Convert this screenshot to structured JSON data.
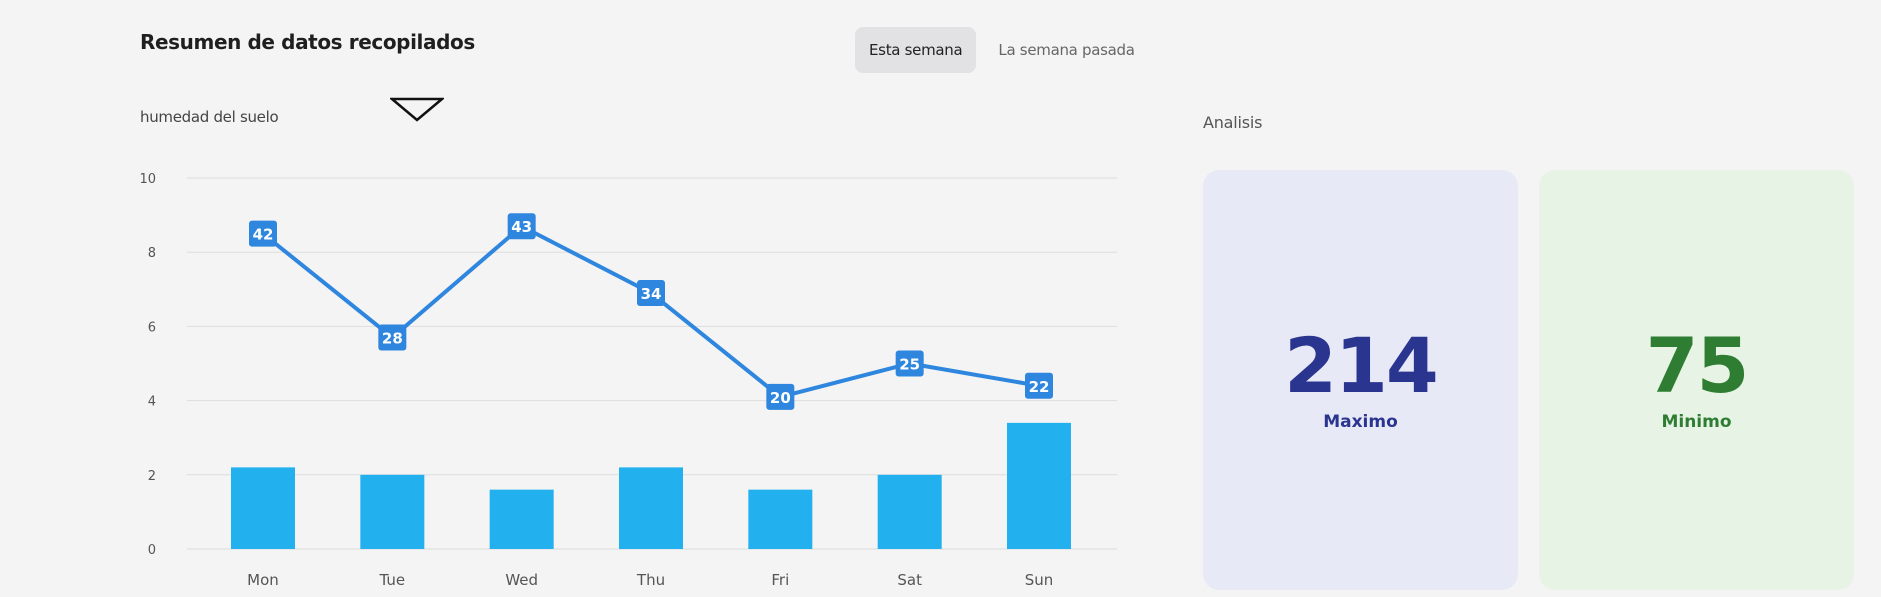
{
  "header": {
    "title": "Resumen de datos recopilados",
    "tabs": [
      {
        "label": "Esta semana",
        "active": true
      },
      {
        "label": "La semana pasada",
        "active": false
      }
    ]
  },
  "metric_selector": {
    "label": "humedad del suelo",
    "icon": "chevron-down-icon"
  },
  "analysis": {
    "label": "Analisis",
    "max": {
      "value": "214",
      "caption": "Maximo"
    },
    "min": {
      "value": "75",
      "caption": "Minimo"
    }
  },
  "colors": {
    "line": "#2e86de",
    "bar": "#22b0ee",
    "grid": "#dddddd",
    "axis_text": "#555555",
    "max_card_bg": "#e8e9f6",
    "max_text": "#2a3590",
    "min_card_bg": "#e7f4e5",
    "min_text": "#2e7d32"
  },
  "chart_data": {
    "type": "bar",
    "categories": [
      "Mon",
      "Tue",
      "Wed",
      "Thu",
      "Fri",
      "Sat",
      "Sun"
    ],
    "ylim": [
      0,
      10
    ],
    "yticks": [
      0,
      2,
      4,
      6,
      8,
      10
    ],
    "grid": true,
    "series": [
      {
        "type": "bar",
        "values": [
          2.2,
          2.0,
          1.6,
          2.2,
          1.6,
          2.0,
          3.4
        ]
      },
      {
        "type": "line",
        "values": [
          8.5,
          5.7,
          8.7,
          6.9,
          4.1,
          5.0,
          4.4
        ],
        "labels": [
          "42",
          "28",
          "43",
          "34",
          "20",
          "25",
          "22"
        ]
      }
    ]
  }
}
